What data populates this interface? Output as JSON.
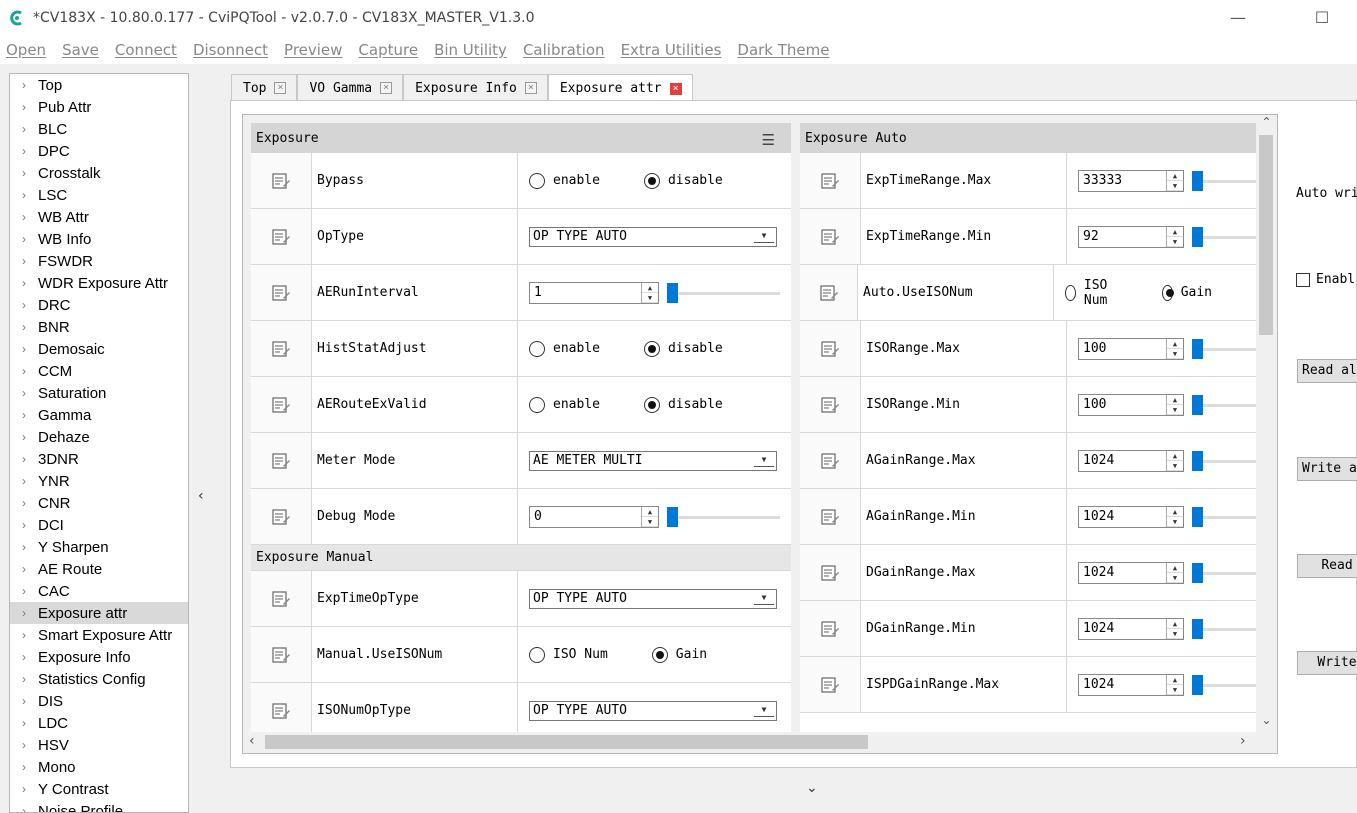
{
  "window": {
    "title": "*CV183X - 10.80.0.177 - CviPQTool - v2.0.7.0 - CV183X_MASTER_V1.3.0",
    "minimize_glyph": "—",
    "maximize_glyph": "☐"
  },
  "menu": [
    "Open",
    "Save",
    "Connect",
    "Disonnect",
    "Preview",
    "Capture",
    "Bin Utility",
    "Calibration",
    "Extra Utilities",
    "Dark Theme"
  ],
  "sidebar": {
    "items": [
      "Top",
      "Pub Attr",
      "BLC",
      "DPC",
      "Crosstalk",
      "LSC",
      "WB Attr",
      "WB Info",
      "FSWDR",
      "WDR Exposure Attr",
      "DRC",
      "BNR",
      "Demosaic",
      "CCM",
      "Saturation",
      "Gamma",
      "Dehaze",
      "3DNR",
      "YNR",
      "CNR",
      "DCI",
      "Y Sharpen",
      "AE Route",
      "CAC",
      "Exposure attr",
      "Smart Exposure Attr",
      "Exposure Info",
      "Statistics Config",
      "DIS",
      "LDC",
      "HSV",
      "Mono",
      "Y Contrast",
      "Noise Profile"
    ],
    "selected": "Exposure attr"
  },
  "tabs": [
    {
      "label": "Top",
      "active": false
    },
    {
      "label": "VO Gamma",
      "active": false
    },
    {
      "label": "Exposure Info",
      "active": false
    },
    {
      "label": "Exposure attr",
      "active": true
    }
  ],
  "exposure": {
    "title": "Exposure",
    "rows": [
      {
        "label": "Bypass",
        "type": "radio",
        "options": [
          "enable",
          "disable"
        ],
        "selected": 1
      },
      {
        "label": "OpType",
        "type": "combo",
        "value": "OP TYPE AUTO"
      },
      {
        "label": "AERunInterval",
        "type": "spin",
        "value": "1",
        "slider": 0.0
      },
      {
        "label": "HistStatAdjust",
        "type": "radio",
        "options": [
          "enable",
          "disable"
        ],
        "selected": 1
      },
      {
        "label": "AERouteExValid",
        "type": "radio",
        "options": [
          "enable",
          "disable"
        ],
        "selected": 1
      },
      {
        "label": "Meter Mode",
        "type": "combo",
        "value": "AE METER MULTI"
      },
      {
        "label": "Debug Mode",
        "type": "spin",
        "value": "0",
        "slider": 0.0
      }
    ]
  },
  "exposure_manual": {
    "title": "Exposure Manual",
    "rows": [
      {
        "label": "ExpTimeOpType",
        "type": "combo",
        "value": "OP TYPE AUTO"
      },
      {
        "label": "Manual.UseISONum",
        "type": "radio",
        "options": [
          "ISO Num",
          "Gain"
        ],
        "selected": 1
      },
      {
        "label": "ISONumOpType",
        "type": "combo",
        "value": "OP TYPE AUTO"
      }
    ]
  },
  "exposure_auto": {
    "title": "Exposure Auto",
    "rows": [
      {
        "label": "ExpTimeRange.Max",
        "type": "spin",
        "value": "33333",
        "slider": 0.0
      },
      {
        "label": "ExpTimeRange.Min",
        "type": "spin",
        "value": "92",
        "slider": 0.0
      },
      {
        "label": "Auto.UseISONum",
        "type": "radio",
        "options": [
          "ISO Num",
          "Gain"
        ],
        "selected": 1
      },
      {
        "label": "ISORange.Max",
        "type": "spin",
        "value": "100",
        "slider": 0.0
      },
      {
        "label": "ISORange.Min",
        "type": "spin",
        "value": "100",
        "slider": 0.0
      },
      {
        "label": "AGainRange.Max",
        "type": "spin",
        "value": "1024",
        "slider": 0.0
      },
      {
        "label": "AGainRange.Min",
        "type": "spin",
        "value": "1024",
        "slider": 0.0
      },
      {
        "label": "DGainRange.Max",
        "type": "spin",
        "value": "1024",
        "slider": 0.0
      },
      {
        "label": "DGainRange.Min",
        "type": "spin",
        "value": "1024",
        "slider": 0.0
      },
      {
        "label": "ISPDGainRange.Max",
        "type": "spin",
        "value": "1024",
        "slider": 0.0
      }
    ]
  },
  "right_panel": {
    "auto_write": "Auto wri",
    "enable_label": "Enabl",
    "read_all": "Read al",
    "write_all": "Write al",
    "read": "Read",
    "write": "Write"
  },
  "glyphs": {
    "collapse": "‹",
    "expand_down": "⌄",
    "list": "☰",
    "up": "⌃",
    "down": "⌄",
    "left": "‹",
    "right": "›"
  },
  "colors": {
    "accent": "#0078d7",
    "close_active": "#e04040",
    "panel_header": "#d5d5d5",
    "selected_row": "#d9d9d9"
  }
}
